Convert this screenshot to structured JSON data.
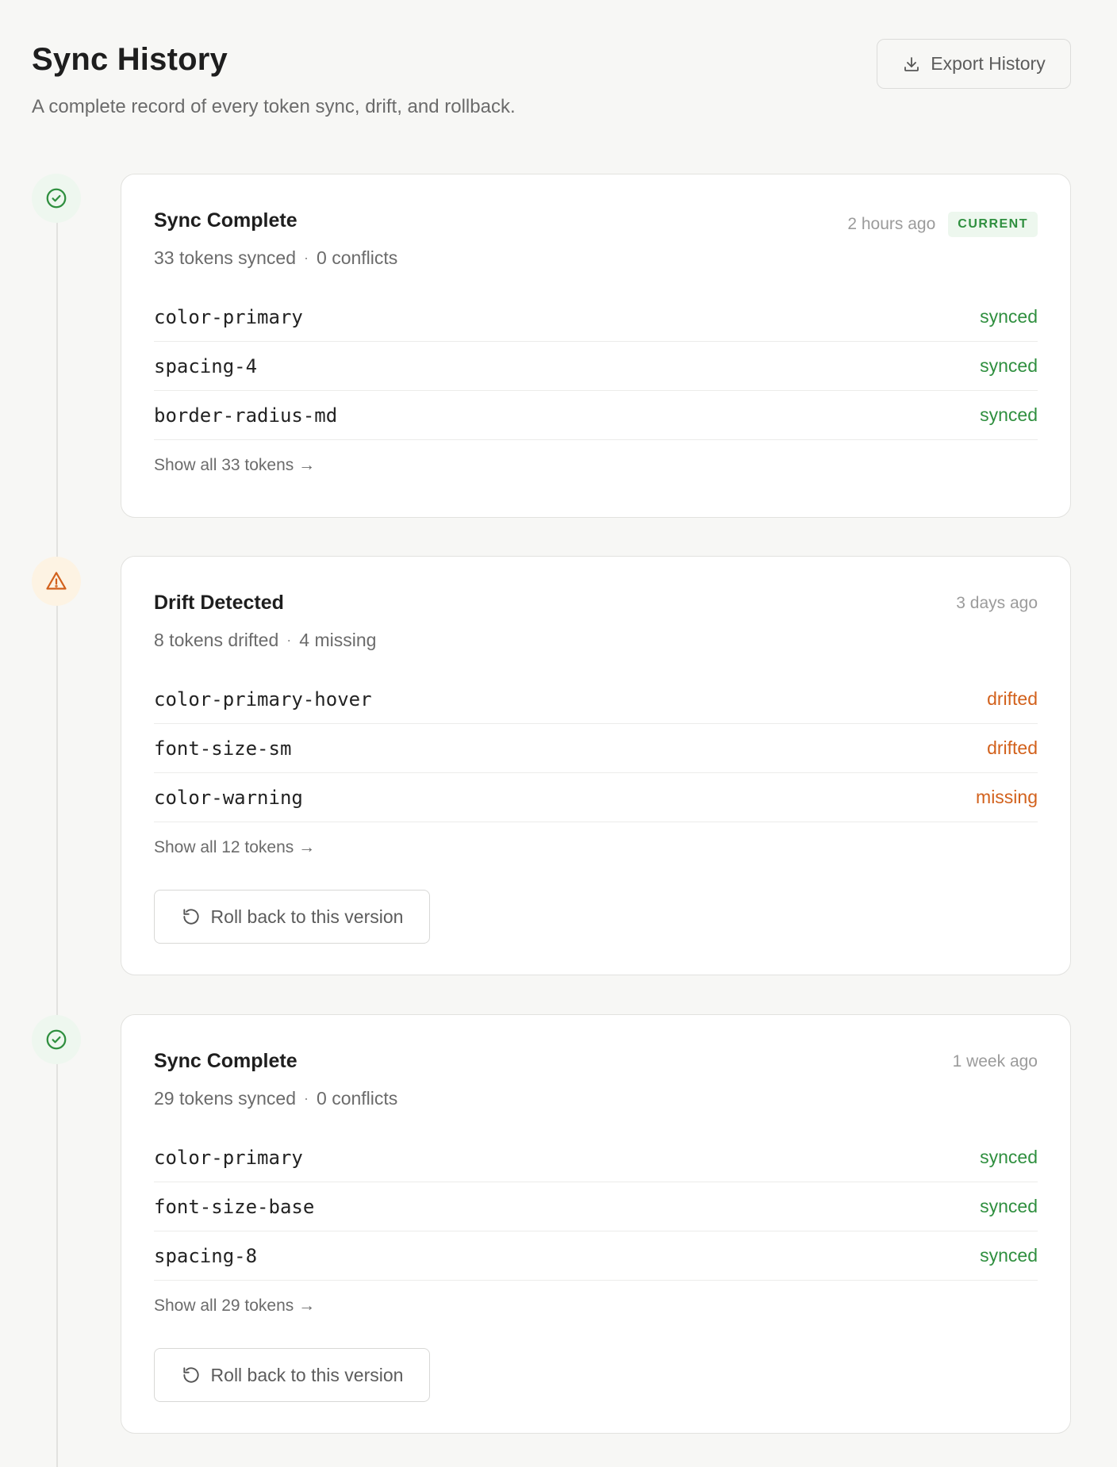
{
  "header": {
    "title": "Sync History",
    "subtitle": "A complete record of every token sync, drift, and rollback.",
    "export_label": "Export History"
  },
  "colors": {
    "success": "#2f8f3f",
    "warning": "#d2611c",
    "background": "#f7f7f5"
  },
  "entries": [
    {
      "status": "success",
      "icon": "check-circle-icon",
      "title": "Sync Complete",
      "time": "2 hours ago",
      "badge": "CURRENT",
      "meta_left": "33 tokens synced",
      "meta_right": "0 conflicts",
      "tokens": [
        {
          "name": "color-primary",
          "status": "synced"
        },
        {
          "name": "spacing-4",
          "status": "synced"
        },
        {
          "name": "border-radius-md",
          "status": "synced"
        }
      ],
      "show_all": "Show all 33 tokens →"
    },
    {
      "status": "warning",
      "icon": "warning-triangle-icon",
      "title": "Drift Detected",
      "time": "3 days ago",
      "meta_left": "8 tokens drifted",
      "meta_right": "4 missing",
      "tokens": [
        {
          "name": "color-primary-hover",
          "status": "drifted"
        },
        {
          "name": "font-size-sm",
          "status": "drifted"
        },
        {
          "name": "color-warning",
          "status": "missing"
        }
      ],
      "show_all": "Show all 12 tokens →",
      "rollback_label": "Roll back to this version"
    },
    {
      "status": "success",
      "icon": "check-circle-icon",
      "title": "Sync Complete",
      "time": "1 week ago",
      "meta_left": "29 tokens synced",
      "meta_right": "0 conflicts",
      "tokens": [
        {
          "name": "color-primary",
          "status": "synced"
        },
        {
          "name": "font-size-base",
          "status": "synced"
        },
        {
          "name": "spacing-8",
          "status": "synced"
        }
      ],
      "show_all": "Show all 29 tokens →",
      "rollback_label": "Roll back to this version"
    }
  ]
}
